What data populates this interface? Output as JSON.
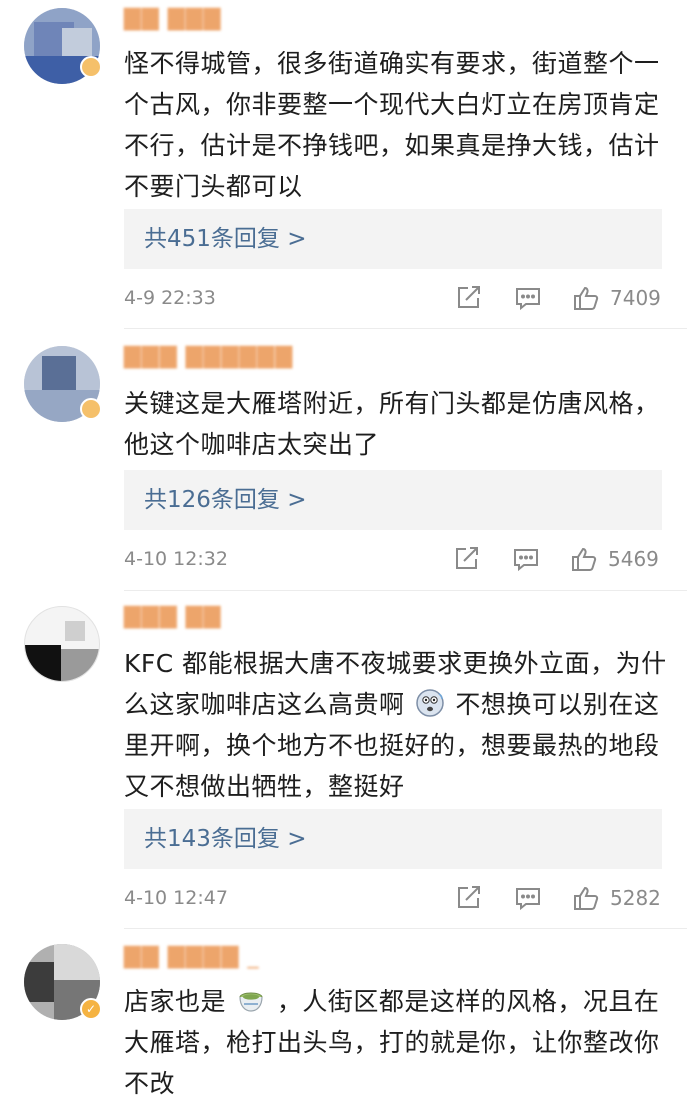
{
  "comments": [
    {
      "username": "▇▇ ▇▇▇",
      "text": "怪不得城管，很多街道确实有要求，街道整个一个古风，你非要整一个现代大白灯立在房顶肯定不行，估计是不挣钱吧，如果真是挣大钱，估计不要门头都可以",
      "reply_label": "共451条回复 >",
      "time": "4-9 22:33",
      "likes": "7409"
    },
    {
      "username": "▇▇▇ ▇▇▇▇▇▇",
      "text": "关键这是大雁塔附近，所有门头都是仿唐风格，他这个咖啡店太突出了",
      "reply_label": "共126条回复 >",
      "time": "4-10 12:32",
      "likes": "5469"
    },
    {
      "username": "▇▇▇ ▇▇",
      "text_a": "KFC 都能根据大唐不夜城要求更换外立面，为什么这家咖啡店这么高贵啊",
      "text_b": "不想换可以别在这里开啊，换个地方不也挺好的，想要最热的地段又不想做出牺牲，整挺好",
      "reply_label": "共143条回复 >",
      "time": "4-10 12:47",
      "likes": "5282"
    },
    {
      "username": "▇▇ ▇▇▇▇ _",
      "text_a": "店家也是",
      "text_b": "，人街区都是这样的风格，况且在大雁塔，枪打出头鸟，打的就是你，让你整改你不改"
    }
  ],
  "icons": {
    "share": "share-icon",
    "comment": "comment-icon",
    "like": "thumbs-up-icon",
    "emoji_1": "speechless-face-emoji",
    "emoji_2": "tea-cup-emoji",
    "verified": "verified-badge-icon"
  },
  "colors": {
    "link": "#4a6d93",
    "meta": "#8a8a8a",
    "reply_bg": "#f3f3f3",
    "username": "#e8873a"
  }
}
